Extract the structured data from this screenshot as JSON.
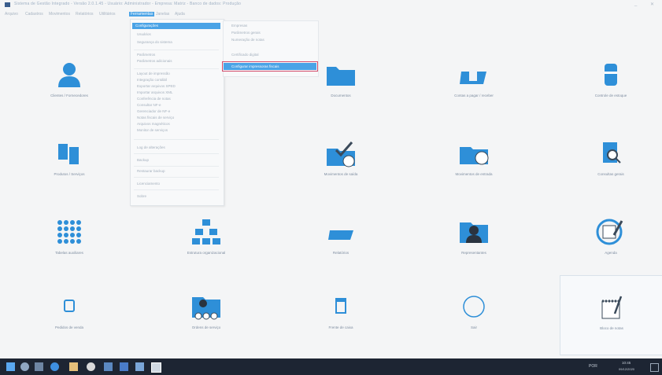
{
  "window": {
    "title": "Sistema de Gestão Integrado - Versão 2.0.1.45 - Usuário: Administrador - Empresa: Matriz - Banco de dados: Produção",
    "minimize": "_",
    "close": "✕"
  },
  "menu": [
    "Arquivo",
    "Cadastros",
    "Movimentos",
    "Relatórios",
    "Utilitários",
    "Ferramentas",
    "Janelas",
    "Ajuda"
  ],
  "active_menu_index": 5,
  "dropdown": {
    "items": [
      {
        "label": "Configurações",
        "highlight": true
      },
      {
        "label": "Usuários"
      },
      {
        "label": "Segurança do sistema"
      },
      {
        "label": "Parâmetros"
      },
      {
        "label": "Parâmetros adicionais"
      },
      {
        "label": "Layout de impressão"
      },
      {
        "label": "Integração contábil"
      },
      {
        "label": "Exportar arquivos SPED"
      },
      {
        "label": "Importar arquivos XML"
      },
      {
        "label": "Conferência de notas"
      },
      {
        "label": "Consultar NF-e"
      },
      {
        "label": "Gerenciador de NF-e"
      },
      {
        "label": "Notas fiscais de serviço"
      },
      {
        "label": "Arquivos magnéticos"
      },
      {
        "label": "Monitor de serviços"
      },
      {
        "label": "Log de alterações"
      },
      {
        "label": "Backup"
      },
      {
        "label": "Restaurar backup"
      },
      {
        "label": "Licenciamento"
      },
      {
        "label": "Sobre"
      }
    ]
  },
  "submenu": {
    "items": [
      {
        "label": "Empresas"
      },
      {
        "label": "Parâmetros gerais"
      },
      {
        "label": "Numeração de notas"
      },
      {
        "label": "Certificado digital"
      },
      {
        "label": "Configurar impressoras fiscais",
        "highlight": true
      }
    ]
  },
  "tiles": [
    {
      "label": "Clientes / Fornecedores",
      "icon": "person-icon"
    },
    {
      "label": "",
      "icon": "blank"
    },
    {
      "label": "Documentos",
      "icon": "folder-icon"
    },
    {
      "label": "Contas a pagar / receber",
      "icon": "folder-docs-icon"
    },
    {
      "label": "Controle de estoque",
      "icon": "database-icon"
    },
    {
      "label": "Produtos / Serviços",
      "icon": "documents-icon"
    },
    {
      "label": "",
      "icon": "blank"
    },
    {
      "label": "Movimentos de saída",
      "icon": "folder-check-icon"
    },
    {
      "label": "Movimentos de entrada",
      "icon": "folder-clock-icon"
    },
    {
      "label": "Consultas gerais",
      "icon": "document-search-icon"
    },
    {
      "label": "Tabelas auxiliares",
      "icon": "grid-icon"
    },
    {
      "label": "Estrutura organizacional",
      "icon": "org-chart-icon"
    },
    {
      "label": "Relatórios",
      "icon": "folder-open-icon"
    },
    {
      "label": "Representantes",
      "icon": "folder-user-icon"
    },
    {
      "label": "Agenda",
      "icon": "notepad-edit-icon"
    },
    {
      "label": "Pedidos de venda",
      "icon": "small-doc-icon"
    },
    {
      "label": "Ordens de serviço",
      "icon": "folder-people-icon"
    },
    {
      "label": "Frente de caixa",
      "icon": "cup-icon"
    },
    {
      "label": "Sair",
      "icon": "circle-icon"
    },
    {
      "label": "Bloco de notas",
      "icon": "notepad-pen-icon"
    }
  ],
  "taskbar": {
    "apps": [
      "start-icon",
      "search-icon",
      "task-view-icon",
      "edge-icon",
      "explorer-icon",
      "chrome-icon",
      "mail-icon",
      "store-icon",
      "app-icon",
      "active-app-icon"
    ],
    "tray_text": "POR",
    "time": "10:45",
    "date": "09/12/2020"
  },
  "colors": {
    "accent": "#2e8fd8",
    "highlight": "#4aa3e6",
    "taskbar": "#1d2533",
    "callout": "#d44d6b"
  }
}
